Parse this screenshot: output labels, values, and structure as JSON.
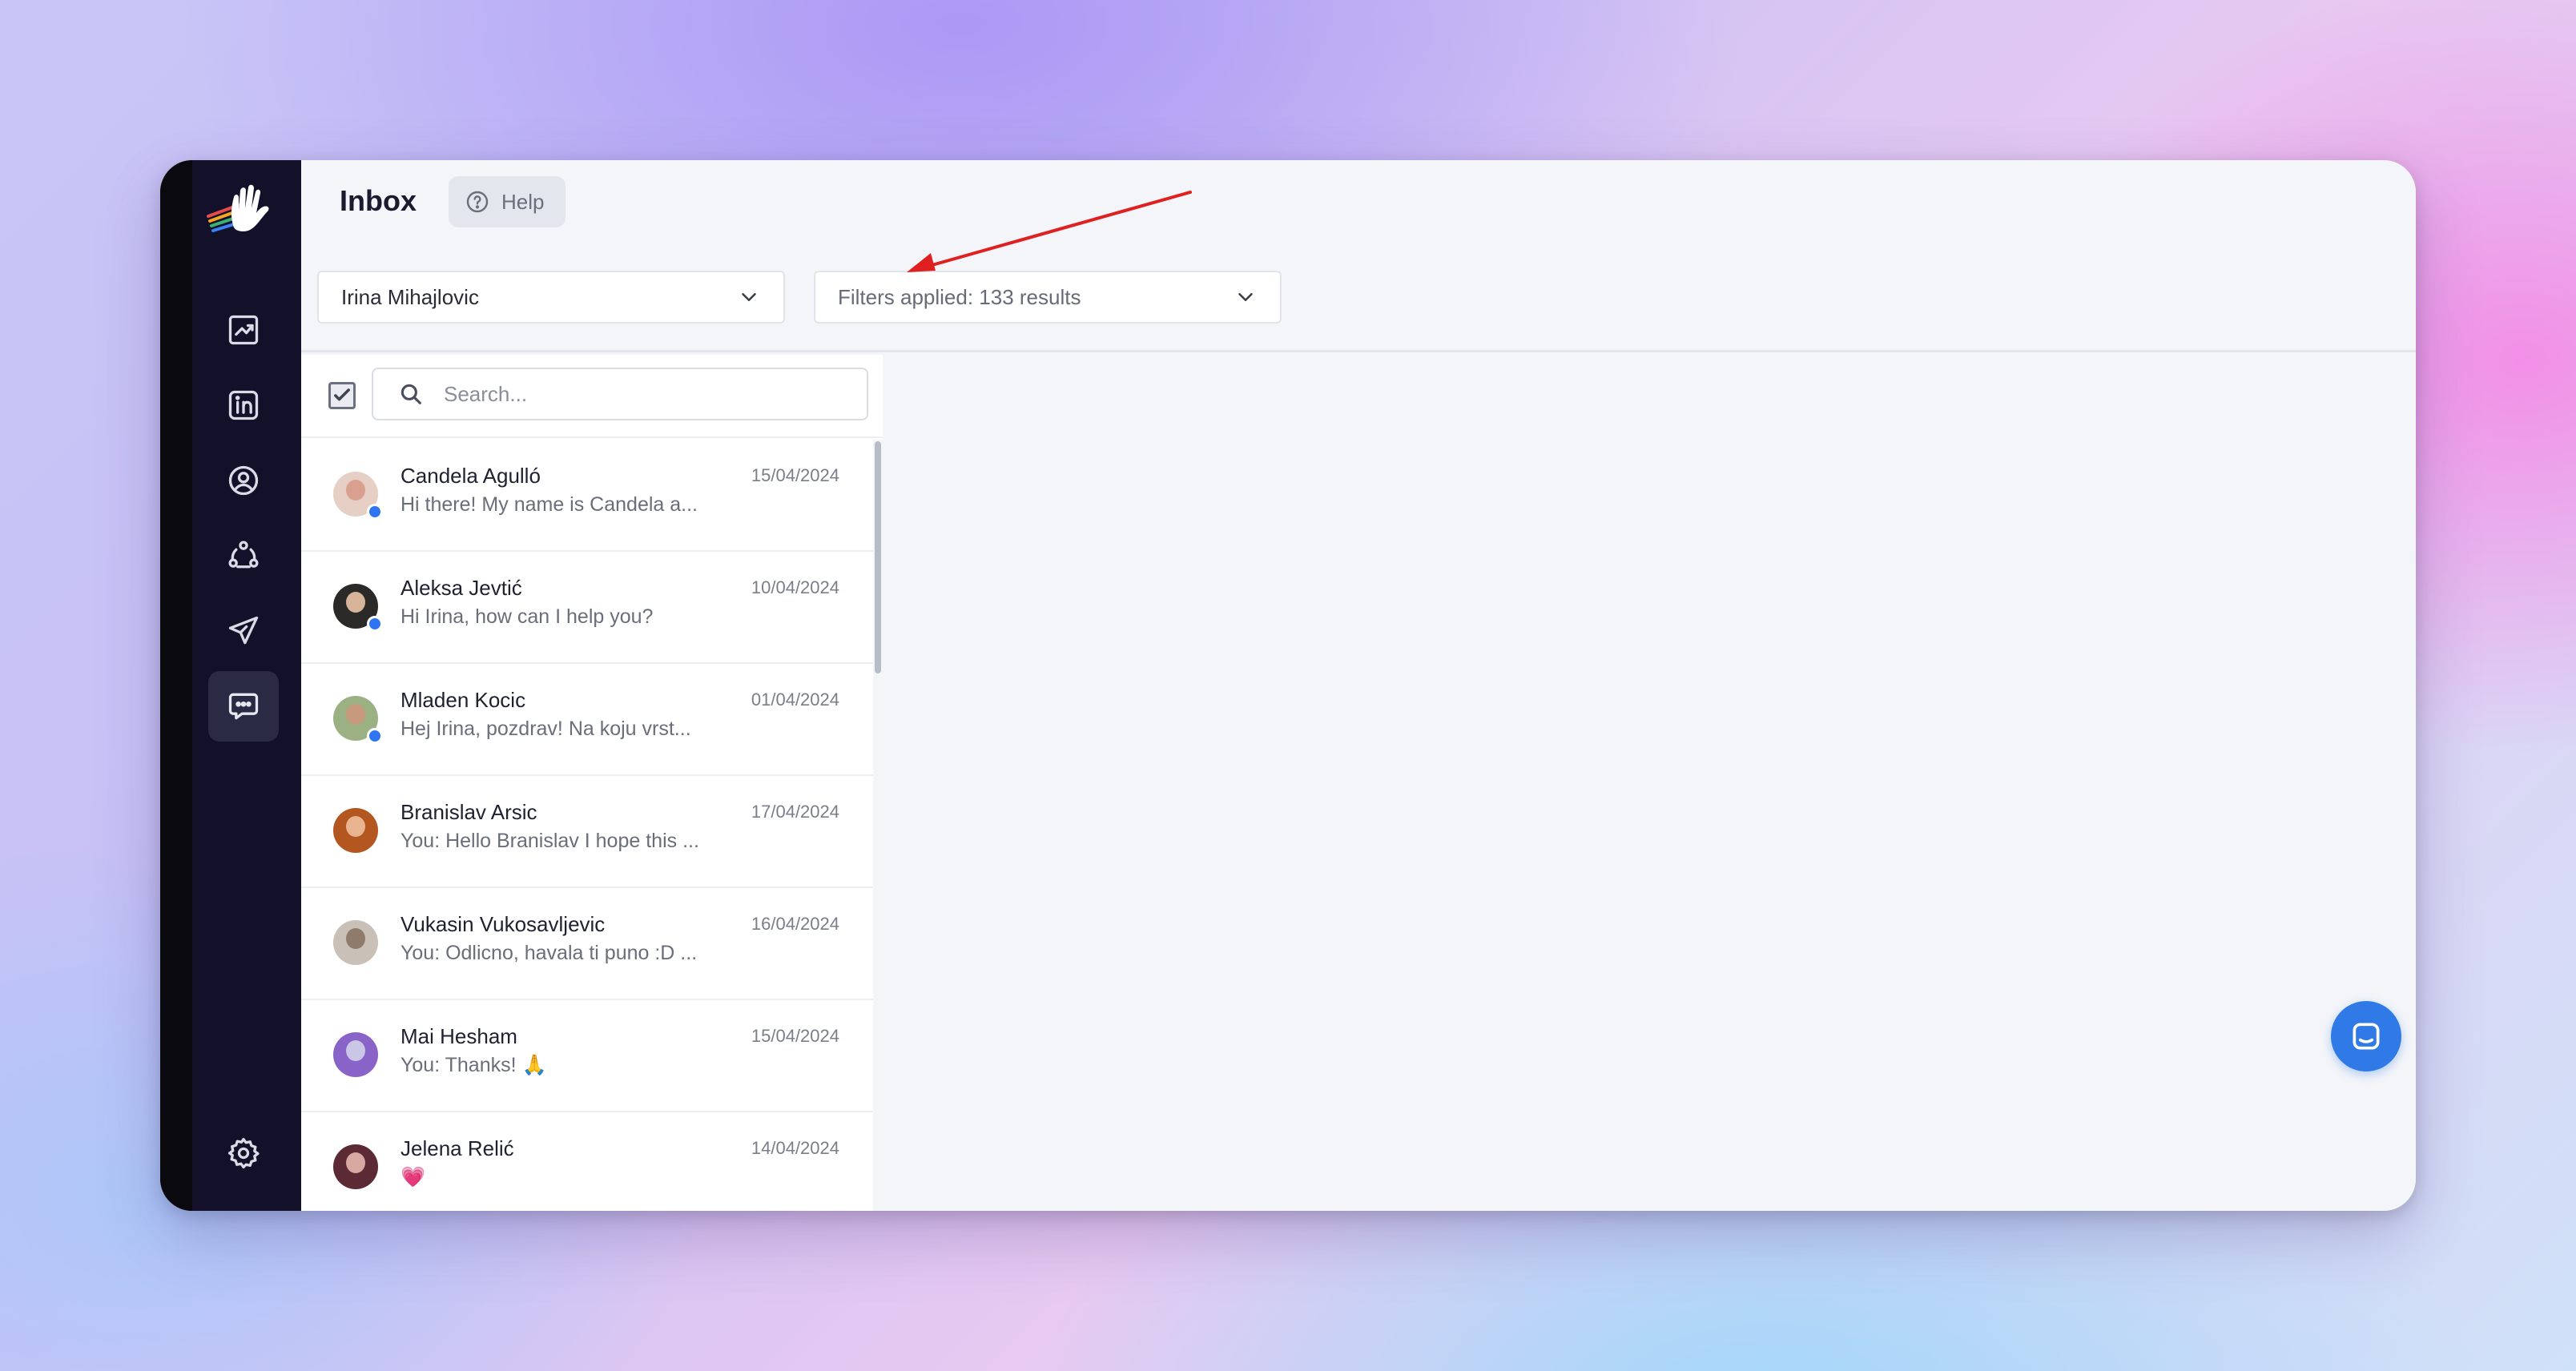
{
  "header": {
    "title": "Inbox",
    "help_label": "Help"
  },
  "account_select": {
    "value": "Irina Mihajlovic"
  },
  "filter_select": {
    "value": "Filters applied: 133 results"
  },
  "search": {
    "placeholder": "Search..."
  },
  "conversations": [
    {
      "name": "Candela Agulló",
      "preview": "Hi there! My name is Candela a...",
      "date": "15/04/2024",
      "online": true,
      "avatar_color": "#d9a08f"
    },
    {
      "name": "Aleksa Jevtić",
      "preview": "Hi Irina, how can I help you?",
      "date": "10/04/2024",
      "online": true,
      "avatar_color": "#3b3936"
    },
    {
      "name": "Mladen Kocic",
      "preview": "Hej Irina, pozdrav! Na koju vrst...",
      "date": "01/04/2024",
      "online": true,
      "avatar_color": "#6f8b57"
    },
    {
      "name": "Branislav Arsic",
      "preview": "You: Hello Branislav I hope this ...",
      "date": "17/04/2024",
      "online": false,
      "avatar_color": "#c86a2c"
    },
    {
      "name": "Vukasin Vukosavljevic",
      "preview": "You: Odlicno, havala ti puno :D ...",
      "date": "16/04/2024",
      "online": false,
      "avatar_color": "#8e7b6c"
    },
    {
      "name": "Mai Hesham",
      "preview": "You: Thanks! 🙏",
      "date": "15/04/2024",
      "online": false,
      "avatar_color": "#8a63c9"
    },
    {
      "name": "Jelena Relić",
      "preview": "💗",
      "date": "14/04/2024",
      "online": false,
      "avatar_color": "#7a3a46"
    }
  ],
  "colors": {
    "sidebar": "#121129",
    "accent": "#2f7ae6",
    "online": "#2f74f0",
    "annotation_arrow": "#e02020"
  }
}
